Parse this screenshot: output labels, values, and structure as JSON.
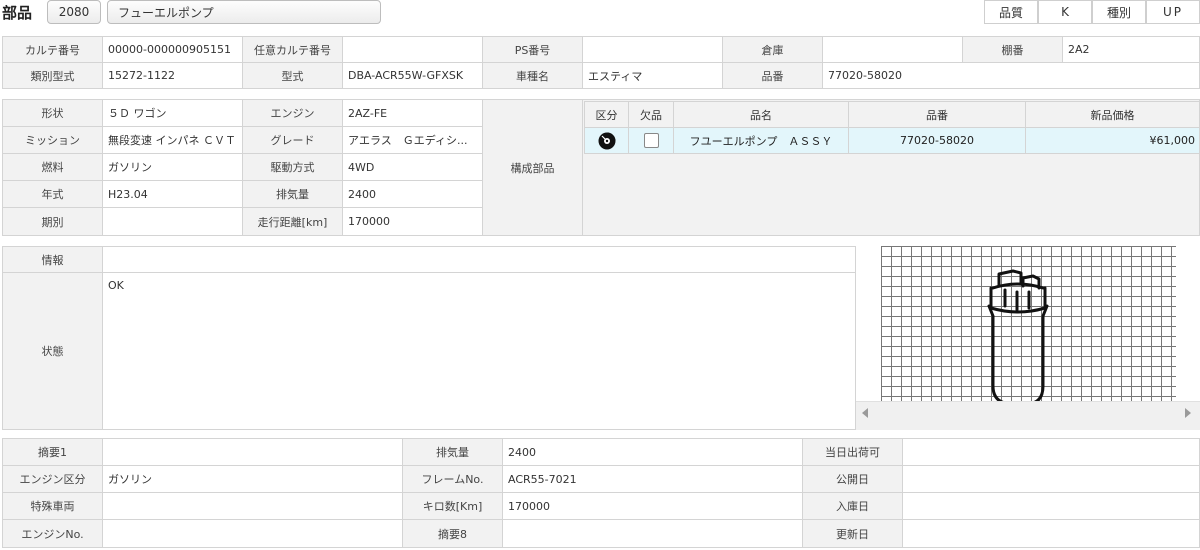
{
  "header": {
    "title": "部品",
    "code": "2080",
    "part_name": "フューエルポンプ",
    "quality_label": "品質",
    "quality_value": "K",
    "type_label": "種別",
    "type_value": "UP"
  },
  "card": {
    "card_no_label": "カルテ番号",
    "card_no": "00000-000000905151",
    "opt_card_no_label": "任意カルテ番号",
    "opt_card_no": "",
    "ps_no_label": "PS番号",
    "ps_no": "",
    "warehouse_label": "倉庫",
    "warehouse": "",
    "shelf_label": "棚番",
    "shelf": "2A2",
    "class_model_label": "類別型式",
    "class_model": "15272-1122",
    "model_label": "型式",
    "model": "DBA-ACR55W-GFXSK",
    "car_name_label": "車種名",
    "car_name": "エスティマ",
    "part_no_label": "品番",
    "part_no": "77020-58020"
  },
  "vehicle": {
    "shape_label": "形状",
    "shape": "５Ｄ ワゴン",
    "engine_label": "エンジン",
    "engine": "2AZ-FE",
    "mission_label": "ミッション",
    "mission": "無段変速 インパネ ＣＶＴ",
    "grade_label": "グレード",
    "grade": "アエラス　Ｇエディシ...",
    "fuel_label": "燃料",
    "fuel": "ガソリン",
    "drive_label": "駆動方式",
    "drive": "4WD",
    "year_label": "年式",
    "year": "H23.04",
    "displacement_label": "排気量",
    "displacement": "2400",
    "period_label": "期別",
    "period": "",
    "mileage_label": "走行距離[km]",
    "mileage": "170000"
  },
  "components": {
    "section_label": "構成部品",
    "col_kubun": "区分",
    "col_missing": "欠品",
    "col_name": "品名",
    "col_part_no": "品番",
    "col_price": "新品価格",
    "rows": [
      {
        "name": "フユーエルポンプ　ＡＳＳＹ",
        "part_no": "77020-58020",
        "price": "¥61,000"
      }
    ]
  },
  "info": {
    "info_label": "情報",
    "info": "",
    "status_label": "状態",
    "status": "OK"
  },
  "summary": {
    "summary1_label": "摘要1",
    "summary1": "",
    "displacement_label": "排気量",
    "displacement": "2400",
    "same_day_label": "当日出荷可",
    "same_day": "",
    "engine_class_label": "エンジン区分",
    "engine_class": "ガソリン",
    "frame_label": "フレームNo.",
    "frame": "ACR55-7021",
    "publish_label": "公開日",
    "publish": "",
    "special_label": "特殊車両",
    "special": "",
    "km_label": "キロ数[Km]",
    "km": "170000",
    "stock_label": "入庫日",
    "stock": "",
    "engine_no_label": "エンジンNo.",
    "engine_no": "",
    "summary8_label": "摘要8",
    "summary8": "",
    "updated_label": "更新日",
    "updated": ""
  },
  "icons": {
    "kubun_icon": "disc-icon",
    "missing_icon": "checkbox-icon",
    "scroll_left_icon": "triangle-left-icon",
    "scroll_right_icon": "triangle-right-icon"
  }
}
